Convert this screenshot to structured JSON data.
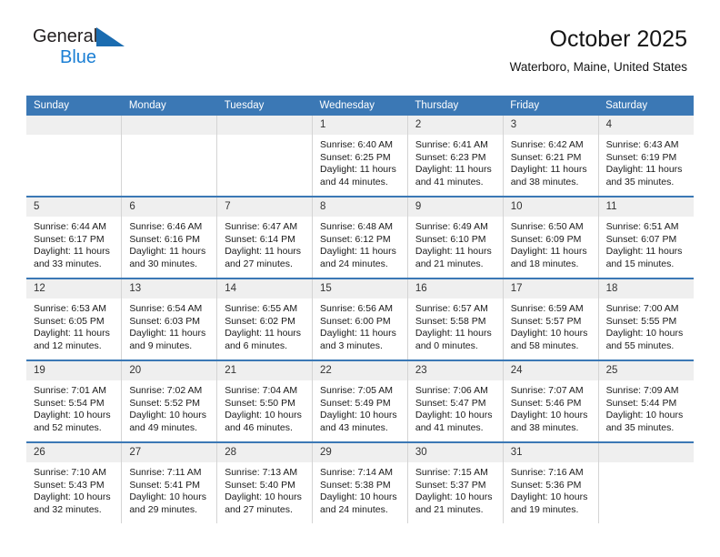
{
  "brand": {
    "name_part1": "General",
    "name_part2": "Blue",
    "triangle_color": "#1b6cb0",
    "accent_color": "#1b7fd4"
  },
  "header": {
    "title": "October 2025",
    "subtitle": "Waterboro, Maine, United States"
  },
  "theme": {
    "header_bg": "#3b78b5",
    "daynum_bg": "#efefef",
    "row_divider": "#3b78b5"
  },
  "weekdays": [
    "Sunday",
    "Monday",
    "Tuesday",
    "Wednesday",
    "Thursday",
    "Friday",
    "Saturday"
  ],
  "weeks": [
    [
      {
        "day": "",
        "sunrise": "",
        "sunset": "",
        "daylight_line1": "",
        "daylight_line2": ""
      },
      {
        "day": "",
        "sunrise": "",
        "sunset": "",
        "daylight_line1": "",
        "daylight_line2": ""
      },
      {
        "day": "",
        "sunrise": "",
        "sunset": "",
        "daylight_line1": "",
        "daylight_line2": ""
      },
      {
        "day": "1",
        "sunrise": "Sunrise: 6:40 AM",
        "sunset": "Sunset: 6:25 PM",
        "daylight_line1": "Daylight: 11 hours",
        "daylight_line2": "and 44 minutes."
      },
      {
        "day": "2",
        "sunrise": "Sunrise: 6:41 AM",
        "sunset": "Sunset: 6:23 PM",
        "daylight_line1": "Daylight: 11 hours",
        "daylight_line2": "and 41 minutes."
      },
      {
        "day": "3",
        "sunrise": "Sunrise: 6:42 AM",
        "sunset": "Sunset: 6:21 PM",
        "daylight_line1": "Daylight: 11 hours",
        "daylight_line2": "and 38 minutes."
      },
      {
        "day": "4",
        "sunrise": "Sunrise: 6:43 AM",
        "sunset": "Sunset: 6:19 PM",
        "daylight_line1": "Daylight: 11 hours",
        "daylight_line2": "and 35 minutes."
      }
    ],
    [
      {
        "day": "5",
        "sunrise": "Sunrise: 6:44 AM",
        "sunset": "Sunset: 6:17 PM",
        "daylight_line1": "Daylight: 11 hours",
        "daylight_line2": "and 33 minutes."
      },
      {
        "day": "6",
        "sunrise": "Sunrise: 6:46 AM",
        "sunset": "Sunset: 6:16 PM",
        "daylight_line1": "Daylight: 11 hours",
        "daylight_line2": "and 30 minutes."
      },
      {
        "day": "7",
        "sunrise": "Sunrise: 6:47 AM",
        "sunset": "Sunset: 6:14 PM",
        "daylight_line1": "Daylight: 11 hours",
        "daylight_line2": "and 27 minutes."
      },
      {
        "day": "8",
        "sunrise": "Sunrise: 6:48 AM",
        "sunset": "Sunset: 6:12 PM",
        "daylight_line1": "Daylight: 11 hours",
        "daylight_line2": "and 24 minutes."
      },
      {
        "day": "9",
        "sunrise": "Sunrise: 6:49 AM",
        "sunset": "Sunset: 6:10 PM",
        "daylight_line1": "Daylight: 11 hours",
        "daylight_line2": "and 21 minutes."
      },
      {
        "day": "10",
        "sunrise": "Sunrise: 6:50 AM",
        "sunset": "Sunset: 6:09 PM",
        "daylight_line1": "Daylight: 11 hours",
        "daylight_line2": "and 18 minutes."
      },
      {
        "day": "11",
        "sunrise": "Sunrise: 6:51 AM",
        "sunset": "Sunset: 6:07 PM",
        "daylight_line1": "Daylight: 11 hours",
        "daylight_line2": "and 15 minutes."
      }
    ],
    [
      {
        "day": "12",
        "sunrise": "Sunrise: 6:53 AM",
        "sunset": "Sunset: 6:05 PM",
        "daylight_line1": "Daylight: 11 hours",
        "daylight_line2": "and 12 minutes."
      },
      {
        "day": "13",
        "sunrise": "Sunrise: 6:54 AM",
        "sunset": "Sunset: 6:03 PM",
        "daylight_line1": "Daylight: 11 hours",
        "daylight_line2": "and 9 minutes."
      },
      {
        "day": "14",
        "sunrise": "Sunrise: 6:55 AM",
        "sunset": "Sunset: 6:02 PM",
        "daylight_line1": "Daylight: 11 hours",
        "daylight_line2": "and 6 minutes."
      },
      {
        "day": "15",
        "sunrise": "Sunrise: 6:56 AM",
        "sunset": "Sunset: 6:00 PM",
        "daylight_line1": "Daylight: 11 hours",
        "daylight_line2": "and 3 minutes."
      },
      {
        "day": "16",
        "sunrise": "Sunrise: 6:57 AM",
        "sunset": "Sunset: 5:58 PM",
        "daylight_line1": "Daylight: 11 hours",
        "daylight_line2": "and 0 minutes."
      },
      {
        "day": "17",
        "sunrise": "Sunrise: 6:59 AM",
        "sunset": "Sunset: 5:57 PM",
        "daylight_line1": "Daylight: 10 hours",
        "daylight_line2": "and 58 minutes."
      },
      {
        "day": "18",
        "sunrise": "Sunrise: 7:00 AM",
        "sunset": "Sunset: 5:55 PM",
        "daylight_line1": "Daylight: 10 hours",
        "daylight_line2": "and 55 minutes."
      }
    ],
    [
      {
        "day": "19",
        "sunrise": "Sunrise: 7:01 AM",
        "sunset": "Sunset: 5:54 PM",
        "daylight_line1": "Daylight: 10 hours",
        "daylight_line2": "and 52 minutes."
      },
      {
        "day": "20",
        "sunrise": "Sunrise: 7:02 AM",
        "sunset": "Sunset: 5:52 PM",
        "daylight_line1": "Daylight: 10 hours",
        "daylight_line2": "and 49 minutes."
      },
      {
        "day": "21",
        "sunrise": "Sunrise: 7:04 AM",
        "sunset": "Sunset: 5:50 PM",
        "daylight_line1": "Daylight: 10 hours",
        "daylight_line2": "and 46 minutes."
      },
      {
        "day": "22",
        "sunrise": "Sunrise: 7:05 AM",
        "sunset": "Sunset: 5:49 PM",
        "daylight_line1": "Daylight: 10 hours",
        "daylight_line2": "and 43 minutes."
      },
      {
        "day": "23",
        "sunrise": "Sunrise: 7:06 AM",
        "sunset": "Sunset: 5:47 PM",
        "daylight_line1": "Daylight: 10 hours",
        "daylight_line2": "and 41 minutes."
      },
      {
        "day": "24",
        "sunrise": "Sunrise: 7:07 AM",
        "sunset": "Sunset: 5:46 PM",
        "daylight_line1": "Daylight: 10 hours",
        "daylight_line2": "and 38 minutes."
      },
      {
        "day": "25",
        "sunrise": "Sunrise: 7:09 AM",
        "sunset": "Sunset: 5:44 PM",
        "daylight_line1": "Daylight: 10 hours",
        "daylight_line2": "and 35 minutes."
      }
    ],
    [
      {
        "day": "26",
        "sunrise": "Sunrise: 7:10 AM",
        "sunset": "Sunset: 5:43 PM",
        "daylight_line1": "Daylight: 10 hours",
        "daylight_line2": "and 32 minutes."
      },
      {
        "day": "27",
        "sunrise": "Sunrise: 7:11 AM",
        "sunset": "Sunset: 5:41 PM",
        "daylight_line1": "Daylight: 10 hours",
        "daylight_line2": "and 29 minutes."
      },
      {
        "day": "28",
        "sunrise": "Sunrise: 7:13 AM",
        "sunset": "Sunset: 5:40 PM",
        "daylight_line1": "Daylight: 10 hours",
        "daylight_line2": "and 27 minutes."
      },
      {
        "day": "29",
        "sunrise": "Sunrise: 7:14 AM",
        "sunset": "Sunset: 5:38 PM",
        "daylight_line1": "Daylight: 10 hours",
        "daylight_line2": "and 24 minutes."
      },
      {
        "day": "30",
        "sunrise": "Sunrise: 7:15 AM",
        "sunset": "Sunset: 5:37 PM",
        "daylight_line1": "Daylight: 10 hours",
        "daylight_line2": "and 21 minutes."
      },
      {
        "day": "31",
        "sunrise": "Sunrise: 7:16 AM",
        "sunset": "Sunset: 5:36 PM",
        "daylight_line1": "Daylight: 10 hours",
        "daylight_line2": "and 19 minutes."
      },
      {
        "day": "",
        "sunrise": "",
        "sunset": "",
        "daylight_line1": "",
        "daylight_line2": ""
      }
    ]
  ]
}
